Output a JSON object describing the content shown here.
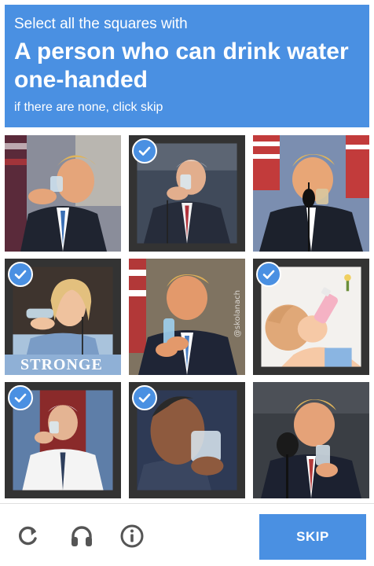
{
  "header": {
    "line1": "Select all the squares with",
    "line2": "A person who can drink water one-handed",
    "line3": "if there are none, click skip",
    "background": "#4a90e2"
  },
  "tiles": [
    {
      "selected": false
    },
    {
      "selected": true
    },
    {
      "selected": false
    },
    {
      "selected": true,
      "caption": "STRONGE"
    },
    {
      "selected": false,
      "watermark": "@skolanach"
    },
    {
      "selected": true
    },
    {
      "selected": true
    },
    {
      "selected": true
    },
    {
      "selected": false
    }
  ],
  "footer": {
    "reload_icon": "reload-icon",
    "audio_icon": "headphones-icon",
    "info_icon": "info-icon",
    "skip_label": "SKIP"
  }
}
